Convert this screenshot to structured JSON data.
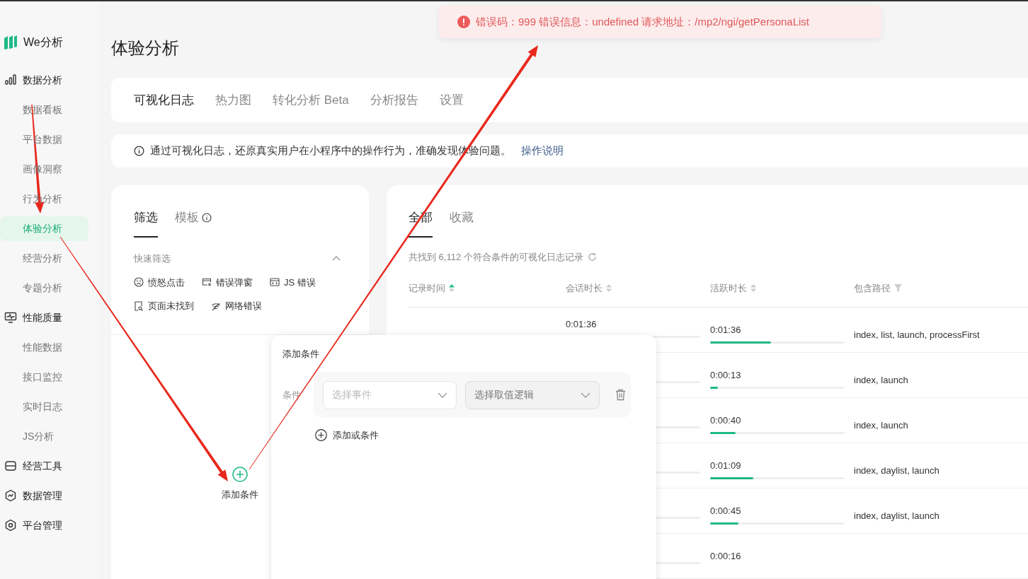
{
  "app": {
    "logo_text": "We分析"
  },
  "sidebar": {
    "groups": [
      {
        "label": "数据分析",
        "children": [
          {
            "label": "数据看板",
            "selected": false
          },
          {
            "label": "平台数据",
            "selected": false
          },
          {
            "label": "画像洞察",
            "selected": false
          },
          {
            "label": "行为分析",
            "selected": false
          },
          {
            "label": "体验分析",
            "selected": true
          },
          {
            "label": "经营分析",
            "selected": false
          },
          {
            "label": "专题分析",
            "selected": false
          }
        ]
      },
      {
        "label": "性能质量",
        "children": [
          {
            "label": "性能数据",
            "selected": false
          },
          {
            "label": "接口监控",
            "selected": false
          },
          {
            "label": "实时日志",
            "selected": false
          },
          {
            "label": "JS分析",
            "selected": false
          }
        ]
      },
      {
        "label": "经营工具"
      },
      {
        "label": "数据管理"
      },
      {
        "label": "平台管理"
      }
    ]
  },
  "page_title": "体验分析",
  "tabs": [
    {
      "label": "可视化日志",
      "selected": true
    },
    {
      "label": "热力图",
      "selected": false
    },
    {
      "label": "转化分析 Beta",
      "selected": false
    },
    {
      "label": "分析报告",
      "selected": false
    },
    {
      "label": "设置",
      "selected": false
    }
  ],
  "info_bar": {
    "text": "通过可视化日志，还原真实用户在小程序中的操作行为，准确发现体验问题。",
    "link": "操作说明"
  },
  "filter_panel": {
    "tabs": [
      {
        "label": "筛选",
        "selected": true,
        "info": false
      },
      {
        "label": "模板",
        "selected": false,
        "info": true
      }
    ],
    "quick_filter": {
      "title": "快速筛选",
      "expanded": true,
      "items": [
        {
          "label": "愤怒点击"
        },
        {
          "label": "错误弹窗"
        },
        {
          "label": "JS 错误"
        },
        {
          "label": "页面未找到"
        },
        {
          "label": "网络错误"
        }
      ]
    },
    "add_condition": "添加条件"
  },
  "records": {
    "tabs": [
      {
        "label": "全部",
        "selected": true
      },
      {
        "label": "收藏",
        "selected": false
      }
    ],
    "summary": "共找到 6,112 个符合条件的可视化日志记录",
    "columns": [
      {
        "label": "记录时间",
        "kind": "sort",
        "sorted": true
      },
      {
        "label": "会话时长",
        "kind": "sort",
        "sorted": false
      },
      {
        "label": "活跃时长",
        "kind": "sort",
        "sorted": false
      },
      {
        "label": "包含路径",
        "kind": "filter"
      }
    ],
    "rows": [
      {
        "session": "0:01:36",
        "active": "0:01:36",
        "level": 0.45,
        "paths": "index, list, launch, processFirst"
      },
      {
        "active": "0:00:13",
        "level": 0.06,
        "paths": "index, launch"
      },
      {
        "active": "0:00:40",
        "level": 0.19,
        "paths": "index, launch"
      },
      {
        "active": "0:01:09",
        "level": 0.32,
        "paths": "index, daylist, launch"
      },
      {
        "active": "0:00:45",
        "level": 0.21,
        "paths": "index, daylist, launch"
      },
      {
        "active": "0:00:16"
      }
    ]
  },
  "popup": {
    "title": "添加条件",
    "condition_label": "条件",
    "event_select": {
      "placeholder": "选择事件",
      "disabled": false
    },
    "logic_select": {
      "placeholder": "选择取值逻辑",
      "disabled": true
    },
    "add_or": "添加或条件"
  },
  "toast": {
    "text": "错误码：999 错误信息：undefined 请求地址：/mp2/ngi/getPersonaList"
  }
}
